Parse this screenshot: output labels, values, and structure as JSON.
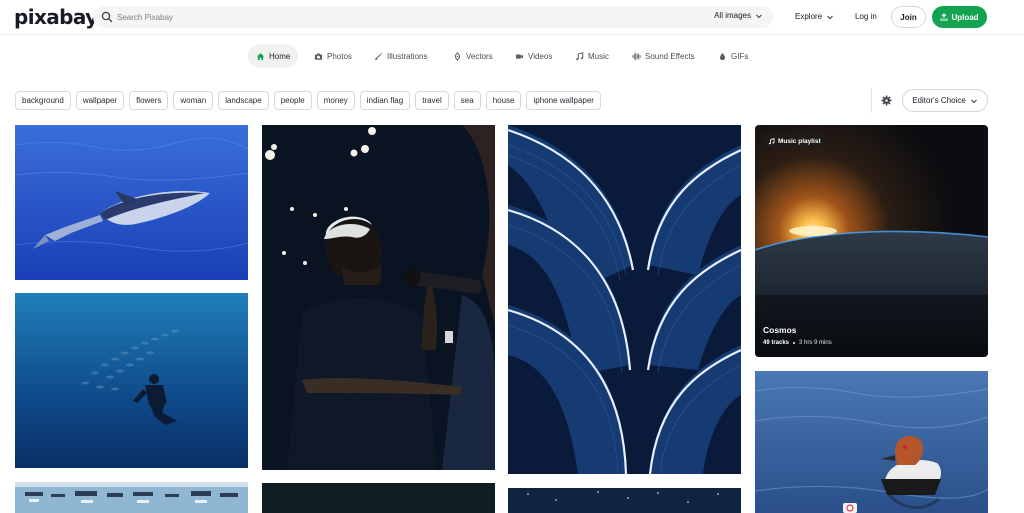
{
  "header": {
    "logo": "pixabay",
    "search_placeholder": "Search Pixabay",
    "media_filter": "All images",
    "explore": "Explore",
    "login": "Log in",
    "join": "Join",
    "upload": "Upload"
  },
  "tabs": [
    {
      "label": "Home",
      "icon": "home-icon",
      "active": true
    },
    {
      "label": "Photos",
      "icon": "camera-icon"
    },
    {
      "label": "Illustrations",
      "icon": "brush-icon"
    },
    {
      "label": "Vectors",
      "icon": "pen-nib-icon"
    },
    {
      "label": "Videos",
      "icon": "video-icon"
    },
    {
      "label": "Music",
      "icon": "music-note-icon"
    },
    {
      "label": "Sound Effects",
      "icon": "sound-wave-icon"
    },
    {
      "label": "GIFs",
      "icon": "gif-drop-icon"
    }
  ],
  "tags": [
    "background",
    "wallpaper",
    "flowers",
    "woman",
    "landscape",
    "people",
    "money",
    "indian flag",
    "travel",
    "sea",
    "house",
    "iphone wallpaper"
  ],
  "sort": {
    "label": "Editor's Choice"
  },
  "playlist": {
    "badge": "Music playlist",
    "title": "Cosmos",
    "tracks": "49 tracks",
    "duration": "3 hrs 9 mins"
  },
  "colors": {
    "accent": "#14a350",
    "text": "#191b26",
    "border": "#d9d9d9"
  }
}
